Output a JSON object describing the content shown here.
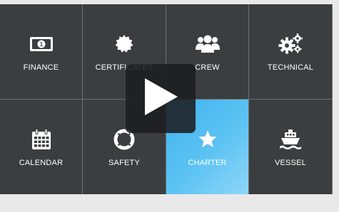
{
  "tiles": [
    {
      "label": "FINANCE",
      "icon": "banknote-icon",
      "active": false
    },
    {
      "label": "CERTIFICATES",
      "icon": "certificate-seal-icon",
      "active": false
    },
    {
      "label": "CREW",
      "icon": "users-group-icon",
      "active": false
    },
    {
      "label": "TECHNICAL",
      "icon": "gears-icon",
      "active": false
    },
    {
      "label": "CALENDAR",
      "icon": "calendar-icon",
      "active": false
    },
    {
      "label": "SAFETY",
      "icon": "life-ring-icon",
      "active": false
    },
    {
      "label": "CHARTER",
      "icon": "star-icon",
      "active": true
    },
    {
      "label": "VESSEL",
      "icon": "ship-icon",
      "active": false
    }
  ],
  "colors": {
    "tile_bg": "#3b3e40",
    "active_tile": "#4dbcf1",
    "text": "#ffffff",
    "divider": "#6c6f71"
  },
  "play_button": {
    "icon": "play-icon"
  }
}
